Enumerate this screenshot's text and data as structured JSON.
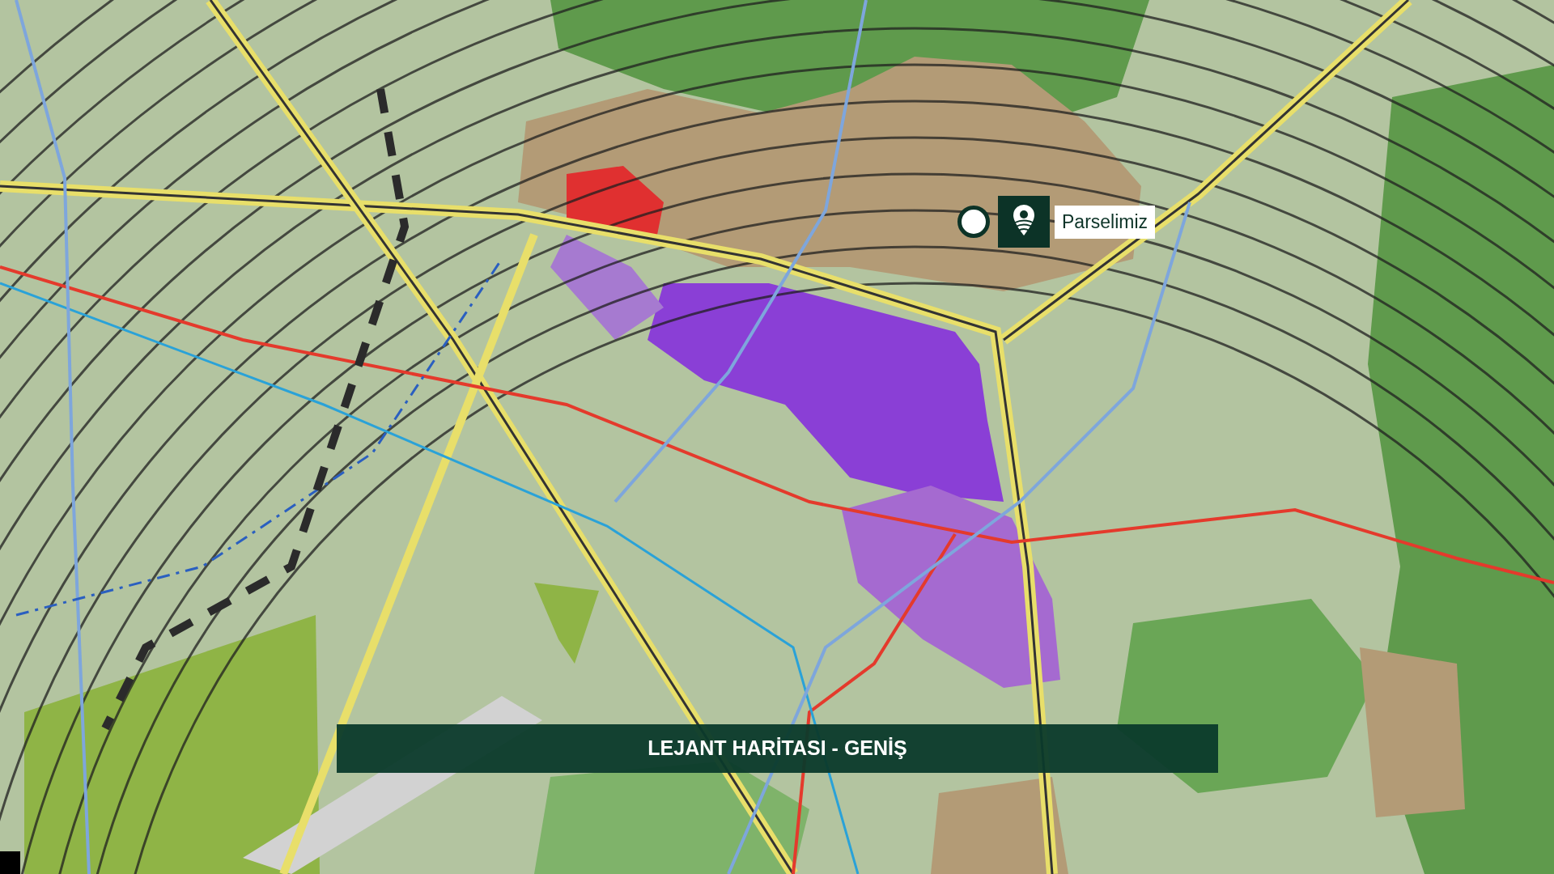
{
  "map": {
    "marker": {
      "label": "Parselimiz"
    }
  },
  "caption": {
    "title": "LEJANT HARİTASI - GENİŞ"
  }
}
